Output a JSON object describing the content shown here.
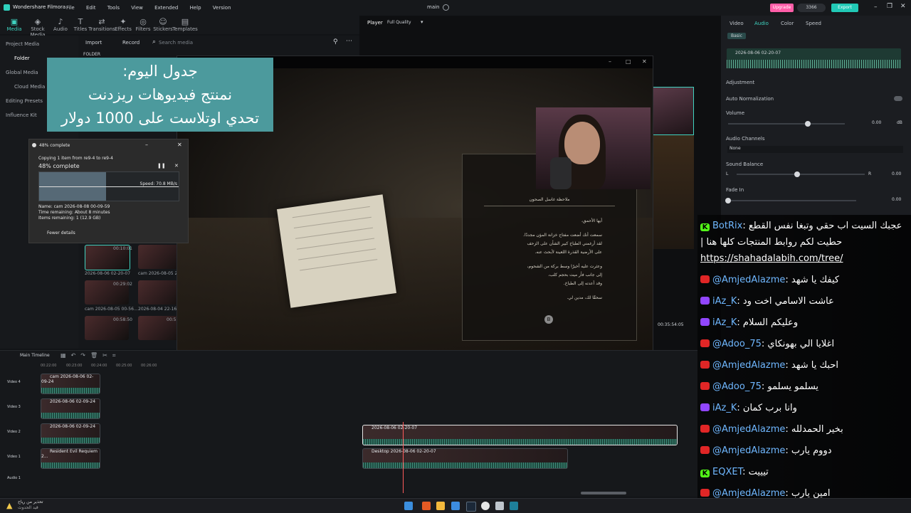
{
  "app": {
    "name": "Wondershare Filmora",
    "menu": [
      "File",
      "Edit",
      "Tools",
      "View",
      "Extended",
      "Help",
      "Version"
    ],
    "project": "main",
    "upgrade": "Upgrade",
    "credits": "3366",
    "export": "Export"
  },
  "toolbar": [
    "Media",
    "Stock Media",
    "Audio",
    "Titles",
    "Transitions",
    "Effects",
    "Filters",
    "Stickers",
    "Templates"
  ],
  "leftnav": [
    "Project Media",
    "Folder",
    "Global Media",
    "Cloud Media",
    "Editing Presets",
    "Influence Kit"
  ],
  "media": {
    "import": "Import",
    "record": "Record",
    "search_placeholder": "Search media",
    "folder": "FOLDER",
    "items": [
      {
        "name": "2026-08-06 02-20-07",
        "dur": "00:10:01"
      },
      {
        "name": "cam 2026-08-05 21-1",
        "dur": ""
      },
      {
        "name": "cam 2026-08-05 00-56...",
        "dur": "00:29:02"
      },
      {
        "name": "2026-08-04 22-16-08",
        "dur": ""
      },
      {
        "name": "",
        "dur": "00:58:50"
      },
      {
        "name": "",
        "dur": "00:52:55"
      }
    ]
  },
  "player": {
    "label": "Player",
    "quality": "Full Quality",
    "timecode": "00:35:54:05"
  },
  "right_panel": {
    "tabs": [
      "Video",
      "Audio",
      "Color",
      "Speed"
    ],
    "subtab": "Basic",
    "clip": "2026-08-06 02-20-07",
    "adjustment": "Adjustment",
    "auto_norm": "Auto Normalization",
    "volume": "Volume",
    "volume_val": "0.00",
    "volume_unit": "dB",
    "volume_level": 0.68,
    "channels": "Audio Channels",
    "channels_val": "None",
    "balance": "Sound Balance",
    "balance_l": "L",
    "balance_r": "R",
    "balance_val": "0.00",
    "balance_level": 0.47,
    "fade_in": "Fade In",
    "fade_in_val": "0.00",
    "fade_level": 0.0
  },
  "banner": {
    "line1": "جدول اليوم:",
    "line2": "نمنتج فيديوهات ريزدنت",
    "line3": "تحدي اوتلاست على 1000 دولار"
  },
  "copy_dialog": {
    "title": "48% complete",
    "line": "Copying 1 item from re9-4 to re9-4",
    "percent_text": "48% complete",
    "progress": 0.48,
    "speed": "Speed: 70.8 MB/s",
    "name": "Name:  cam 2026-08-08 00-09-59",
    "time": "Time remaining:  About 8 minutes",
    "items": "Items remaining:  1 (12.9 GB)",
    "fewer": "Fewer details"
  },
  "note": {
    "title": "ملاحظة غاسل الصحون",
    "greeting": "أيها الأحمق،",
    "p1": "سمعت أنك أضعت مفتاح خزانة المؤن مجددًا.",
    "p2": "لقد أرغمني الطباخ كبير الشأن على الزحف",
    "p3": "على الأرضية القذرة اللعينة لأبحث عنه.",
    "p4": "وعثرت عليه أخيرًا وسط بركة من الشحوم،",
    "p5": "إلى جانب فأر ميت بحجم كلب،",
    "p6": "وقد أعدته إلى الطباخ.",
    "p7": "سحقًا لك، مدين لي.",
    "key": "B"
  },
  "timeline": {
    "name": "Main Timeline",
    "ruler": [
      "00:22:00",
      "00:23:00",
      "00:24:00",
      "00:25:00",
      "00:26:00",
      "00:27:00",
      "00:28:00"
    ],
    "tracks": [
      "Video 4",
      "Video 3",
      "Video 2",
      "Video 1",
      "Audio 1"
    ],
    "clips": {
      "v4": "cam 2026-08-06 02-09-24",
      "v3": "2026-08-06 02-09-24",
      "v2": "2026-08-06 02-09-24",
      "v1": "Resident Evil Requiem 2...",
      "main": "2026-08-06 02-20-07",
      "desktop": "Desktop 2026-08-06 02-20-07"
    }
  },
  "chat": [
    {
      "platform": "kick",
      "user": "BotRix",
      "msg": " عجبك السيت اب حقي وتبغا نفس القطع"
    },
    {
      "platform": "",
      "user": "",
      "msg": "| حطيت لكم روابط المنتجات كلها هنا"
    },
    {
      "platform": "",
      "user": "",
      "msg": "https://shahadalabih.com/tree/",
      "link": true
    },
    {
      "platform": "yt",
      "user": "@AmjedAlazme",
      "msg": " كيفك يا شهد"
    },
    {
      "platform": "tw",
      "user": "iAz_K",
      "msg": " عاشت الاسامي اخت ود"
    },
    {
      "platform": "tw",
      "user": "iAz_K",
      "msg": " وعليكم السلام"
    },
    {
      "platform": "yt",
      "user": "@Adoo_75",
      "msg": " اغلايا الي بهونكاي"
    },
    {
      "platform": "yt",
      "user": "@AmjedAlazme",
      "msg": " احبك يا شهد"
    },
    {
      "platform": "yt",
      "user": "@Adoo_75",
      "msg": " يسلمو يسلمو"
    },
    {
      "platform": "tw",
      "user": "iAz_K",
      "msg": " وانا برب كمان"
    },
    {
      "platform": "yt",
      "user": "@AmjedAlazme",
      "msg": " بخير الحمدلله"
    },
    {
      "platform": "yt",
      "user": "@AmjedAlazme",
      "msg": " دووم يارب"
    },
    {
      "platform": "kick",
      "user": "EQXET",
      "msg": " تيييت"
    },
    {
      "platform": "yt",
      "user": "@AmjedAlazme",
      "msg": " امين يارب"
    }
  ],
  "taskbar": {
    "warning_line1": "تحذير من رياح",
    "warning_line2": "قيد الحدوث"
  },
  "colors": {
    "accent": "#3fd3c0",
    "upgrade": "#ff5ea8",
    "export": "#21c9b6",
    "banner": "#4c9a9d"
  }
}
